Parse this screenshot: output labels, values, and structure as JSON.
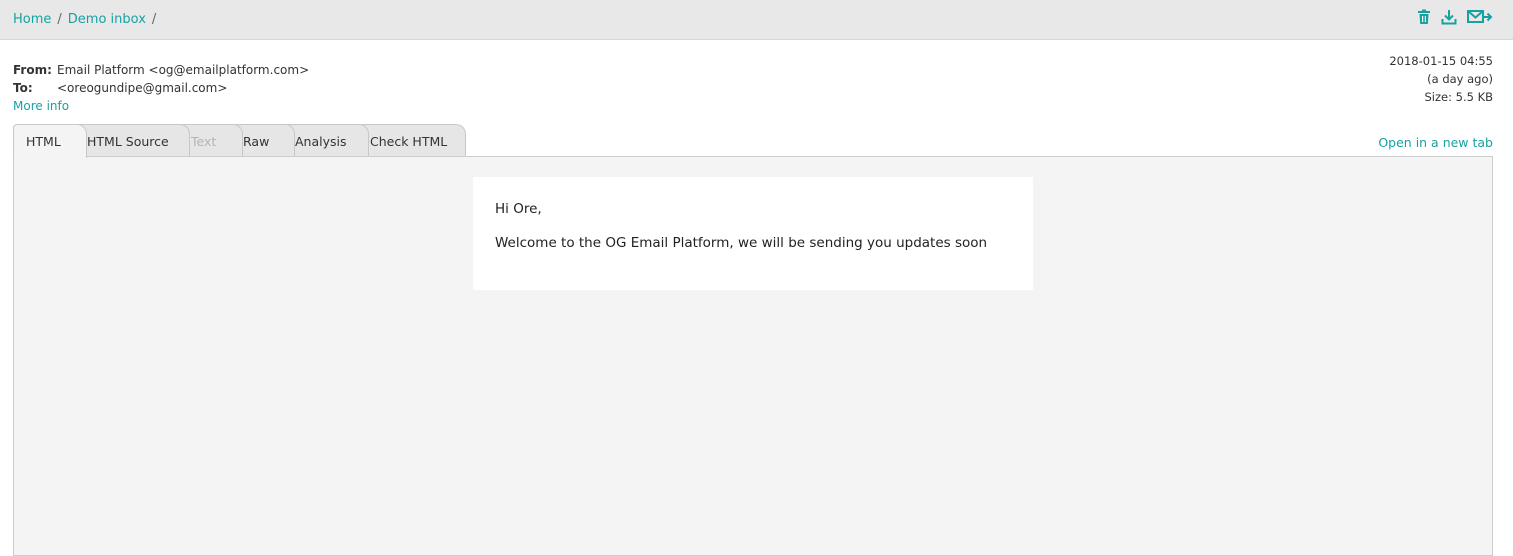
{
  "breadcrumb": {
    "home": "Home",
    "inbox": "Demo inbox",
    "separator": "/"
  },
  "toolbar": {
    "icons": [
      "trash-icon",
      "download-icon",
      "forward-mail-icon"
    ],
    "accent_color": "#17a2a2"
  },
  "message": {
    "from_label": "From:",
    "from_value": "Email Platform <og@emailplatform.com>",
    "to_label": "To:",
    "to_value": "<oreogundipe@gmail.com>",
    "more_info": "More info",
    "date": "2018-01-15 04:55",
    "relative": "(a day ago)",
    "size": "Size: 5.5 KB"
  },
  "tabs": [
    {
      "label": "HTML",
      "state": "active"
    },
    {
      "label": "HTML Source",
      "state": "normal"
    },
    {
      "label": "Text",
      "state": "disabled"
    },
    {
      "label": "Raw",
      "state": "normal"
    },
    {
      "label": "Analysis",
      "state": "normal"
    },
    {
      "label": "Check HTML",
      "state": "normal"
    }
  ],
  "open_new_tab": "Open in a new tab",
  "email_body": {
    "greeting": "Hi Ore,",
    "text": "Welcome to the OG Email Platform, we will be sending you updates soon"
  }
}
